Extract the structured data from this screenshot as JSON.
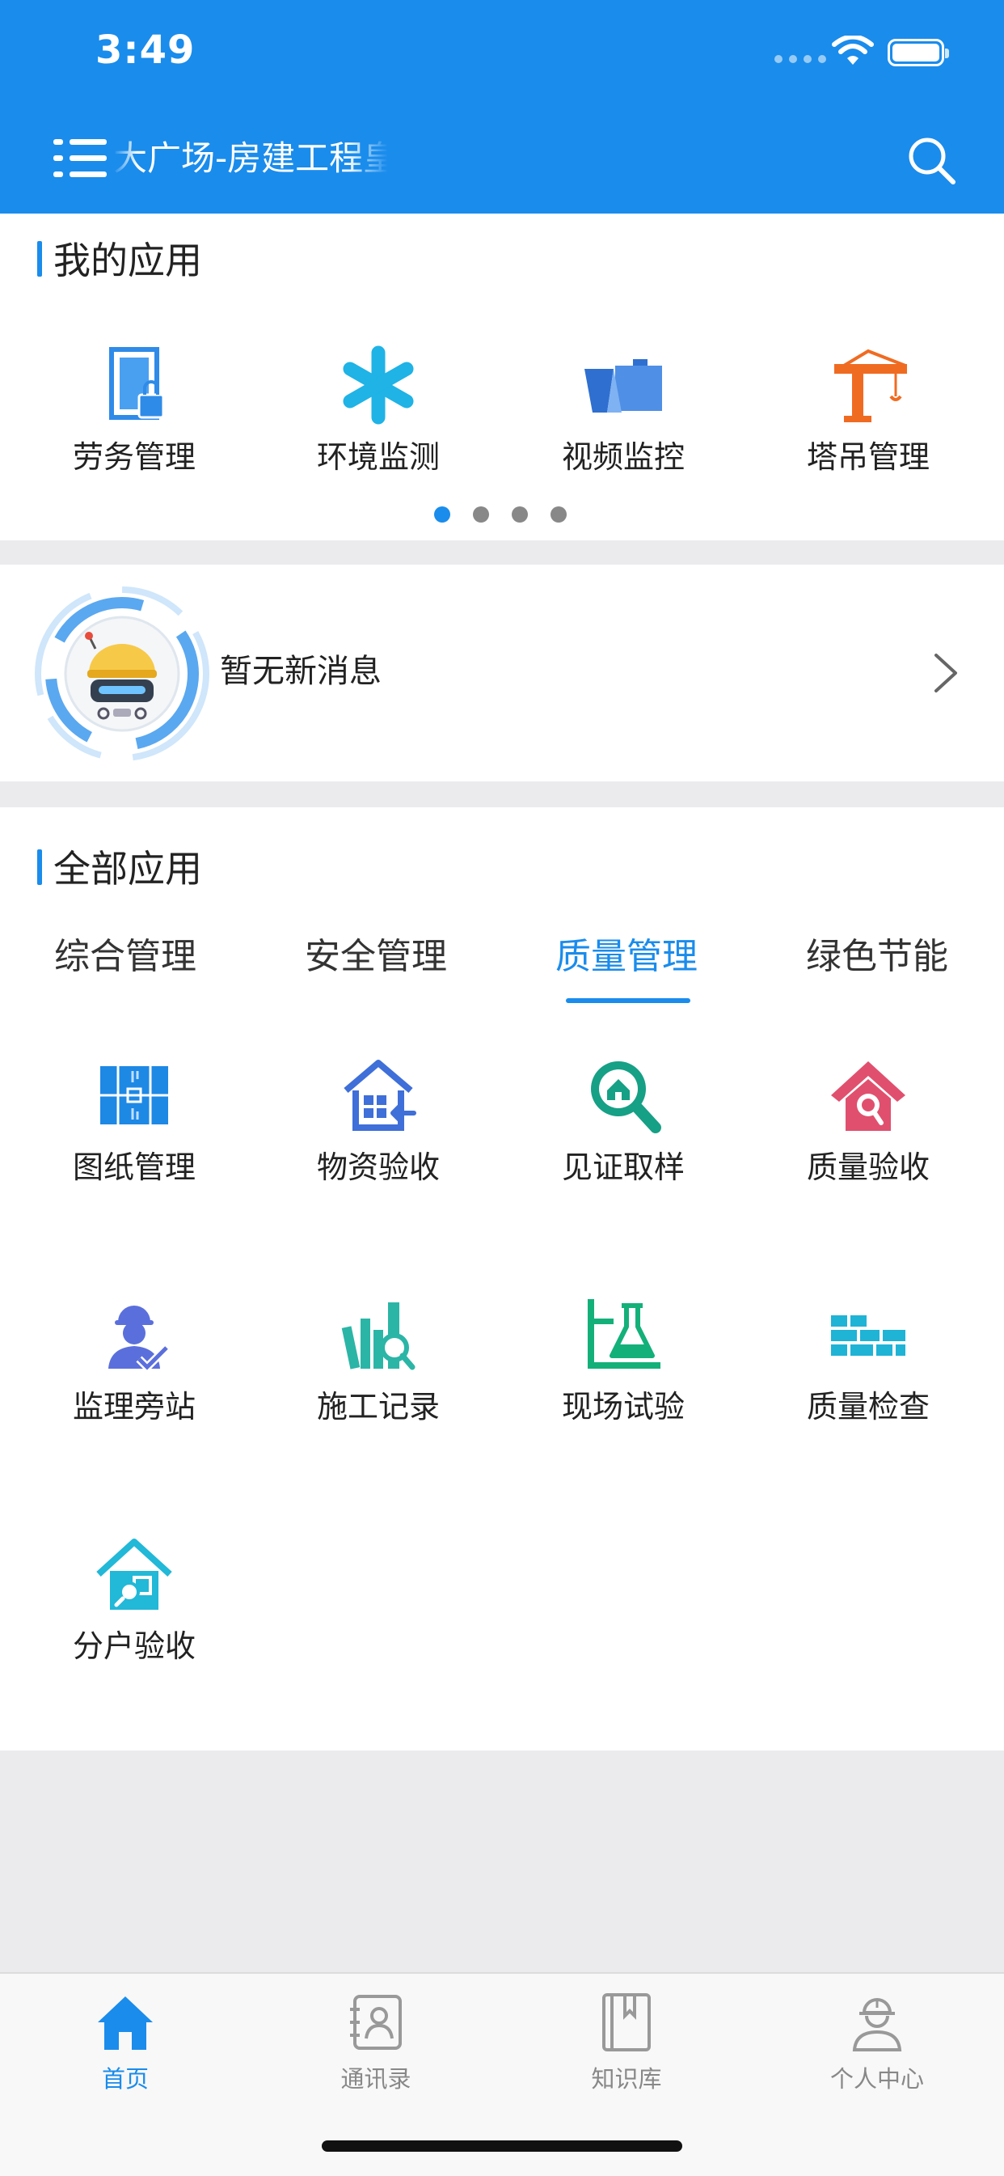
{
  "status": {
    "time": "3:49"
  },
  "header": {
    "title": "大广场-房建工程皇"
  },
  "my_apps": {
    "title": "我的应用",
    "items": [
      {
        "label": "劳务管理",
        "icon": "labor-door-icon",
        "color": "#2f8be8"
      },
      {
        "label": "环境监测",
        "icon": "asterisk-icon",
        "color": "#1fb3e6"
      },
      {
        "label": "视频监控",
        "icon": "folder-video-icon",
        "color": "#4f8fe6"
      },
      {
        "label": "塔吊管理",
        "icon": "tower-crane-icon",
        "color": "#f06b22"
      }
    ],
    "pages": 4,
    "active_page": 1
  },
  "message": {
    "text": "暂无新消息"
  },
  "all_apps": {
    "title": "全部应用",
    "tabs": [
      {
        "label": "综合管理"
      },
      {
        "label": "安全管理"
      },
      {
        "label": "质量管理"
      },
      {
        "label": "绿色节能"
      }
    ],
    "active_tab": "质量管理",
    "items": [
      {
        "label": "图纸管理",
        "icon": "blueprint-icon",
        "color": "#1e88e5"
      },
      {
        "label": "物资验收",
        "icon": "house-checkin-icon",
        "color": "#3f6fd8"
      },
      {
        "label": "见证取样",
        "icon": "house-magnifier-icon",
        "color": "#16a085"
      },
      {
        "label": "质量验收",
        "icon": "house-search-icon",
        "color": "#e0506e"
      },
      {
        "label": "监理旁站",
        "icon": "supervisor-icon",
        "color": "#5b6fdc"
      },
      {
        "label": "施工记录",
        "icon": "books-search-icon",
        "color": "#2bb5a6"
      },
      {
        "label": "现场试验",
        "icon": "flask-icon",
        "color": "#14b07a"
      },
      {
        "label": "质量检查",
        "icon": "brick-wall-icon",
        "color": "#1fb3d6"
      },
      {
        "label": "分户验收",
        "icon": "house-inspect-icon",
        "color": "#22b8d8"
      }
    ]
  },
  "tabbar": {
    "items": [
      {
        "label": "首页",
        "icon": "home-icon"
      },
      {
        "label": "通讯录",
        "icon": "contacts-icon"
      },
      {
        "label": "知识库",
        "icon": "book-icon"
      },
      {
        "label": "个人中心",
        "icon": "worker-icon"
      }
    ],
    "active": "首页"
  },
  "colors": {
    "primary": "#1a8cec",
    "background": "#ebebee"
  }
}
